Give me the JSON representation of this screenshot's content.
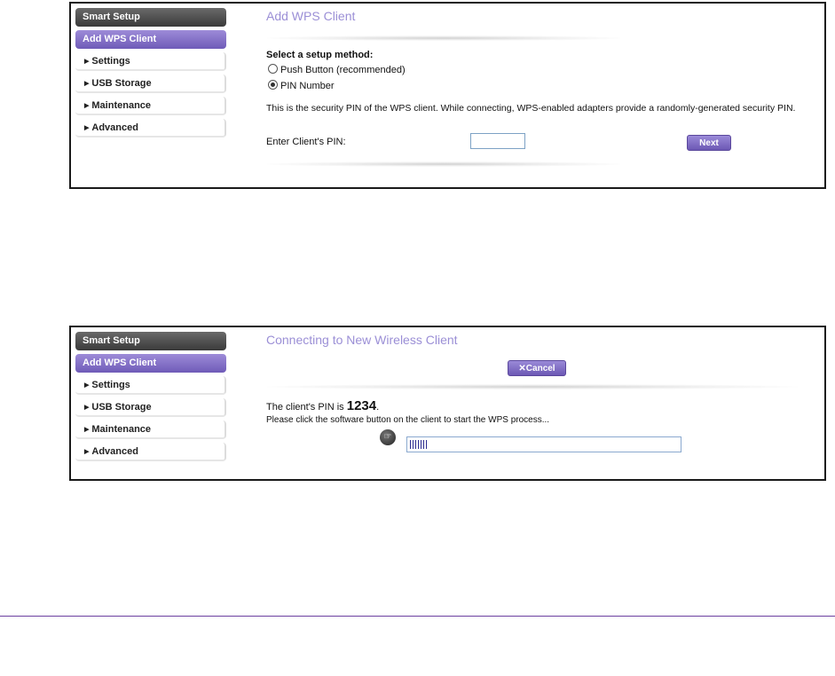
{
  "sidebar": {
    "items": [
      {
        "label": "Smart Setup"
      },
      {
        "label": "Add WPS Client"
      },
      {
        "label": "Settings"
      },
      {
        "label": "USB Storage"
      },
      {
        "label": "Maintenance"
      },
      {
        "label": "Advanced"
      }
    ],
    "arrow_glyph": "▶"
  },
  "screen1": {
    "title": "Add WPS Client",
    "select_label": "Select a setup method:",
    "option_push": "Push Button (recommended)",
    "option_pin": "PIN Number",
    "selected_option": "PIN Number",
    "description": "This is the security PIN of the WPS client. While connecting, WPS-enabled adapters provide a randomly-generated security PIN.",
    "enter_pin_label": "Enter Client's PIN:",
    "pin_value": "",
    "next_button": "Next"
  },
  "screen2": {
    "title": "Connecting to New Wireless Client",
    "cancel_button": "Cancel",
    "cancel_icon": "✕",
    "pin_prefix": "The client's PIN is ",
    "pin_value": "1234",
    "pin_suffix": ".",
    "instruction": "Please click the software button on the client to start the WPS process...",
    "progress_fraction": 0.07,
    "wps_icon_glyph": "☞"
  },
  "colors": {
    "accent_purple": "#9b8fd6",
    "button_purple": "#6c58b4",
    "divider_purple": "#6b3fa0",
    "panel_border": "#1a1a1a"
  }
}
